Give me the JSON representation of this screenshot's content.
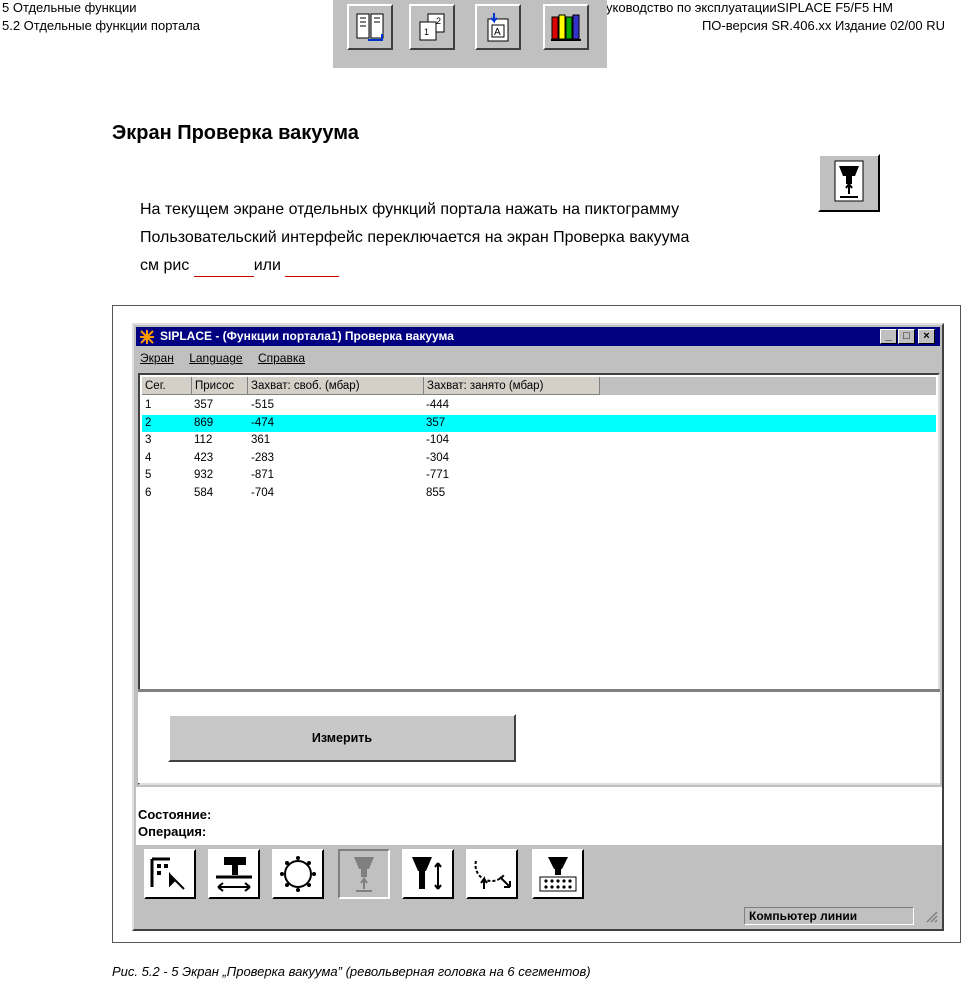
{
  "header": {
    "chapter": "5 Отдельные функции",
    "section": "5.2 Отдельные функции портала",
    "manual": "уководство по эксплуатацииSIPLACE F5/F5 HM",
    "version": "ПО-версия SR.406.xx   Издание 02/00 RU",
    "nav_icons": [
      "contents-icon",
      "pages-icon",
      "index-icon",
      "library-icon"
    ]
  },
  "title": "Экран   Проверка вакуума",
  "para": {
    "line1": "На текущем экране отдельных функций портала    нажать на пиктограмму",
    "line2": "Пользовательский интерфейс переключается на экран  Проверка вакуума",
    "line3_a": " см  рис ",
    "line3_b": "или"
  },
  "window": {
    "title": "SIPLACE - (Функции портала1) Проверка вакуума",
    "menu": [
      "Экран",
      "Language",
      "Справка"
    ],
    "columns": [
      "Сег.",
      "Присос",
      "Захват: своб. (мбар)",
      "Захват: занято (мбар)"
    ],
    "rows": [
      [
        "1",
        "357",
        "-515",
        "-444"
      ],
      [
        "2",
        "869",
        "-474",
        "357"
      ],
      [
        "3",
        "112",
        "361",
        "-104"
      ],
      [
        "4",
        "423",
        "-283",
        "-304"
      ],
      [
        "5",
        "932",
        "-871",
        "-771"
      ],
      [
        "6",
        "584",
        "-704",
        "855"
      ]
    ],
    "selected_row": 2,
    "measure_button": "Измерить",
    "status_label": "Состояние:",
    "operation_label": "Операция:",
    "status_field": "Компьютер линии",
    "toolbar_icons": [
      "component-select-icon",
      "gripper-move-icon",
      "revolver-head-icon",
      "vacuum-test-icon",
      "pipette-height-icon",
      "rotation-icon",
      "nozzle-changer-icon"
    ],
    "highlight_color": "#00ffff",
    "titlebar_color": "#000080"
  },
  "caption": "Рис. 5.2 - 5       Экран „Проверка вакуума” (револьверная головка на 6 сегментов)"
}
